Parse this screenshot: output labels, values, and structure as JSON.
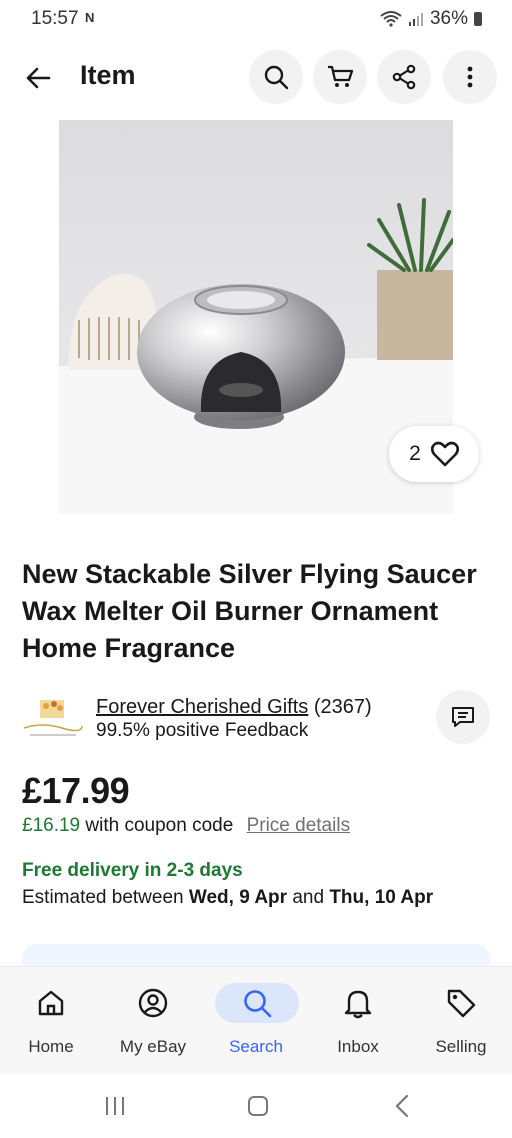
{
  "status": {
    "time": "15:57",
    "notif_icon": "N",
    "battery": "36%"
  },
  "appbar": {
    "title": "Item",
    "icons": [
      "back-arrow-icon",
      "search-icon",
      "cart-icon",
      "share-icon",
      "more-vertical-icon"
    ]
  },
  "listing": {
    "like_count": "2",
    "title": "New Stackable Silver Flying Saucer Wax Melter Oil Burner Ornament Home Fragrance"
  },
  "seller": {
    "name": "Forever Cherished Gifts",
    "count": "(2367)",
    "feedback": "99.5% positive Feedback"
  },
  "pricing": {
    "price": "£17.99",
    "coupon_price": "£16.19",
    "coupon_text": "with coupon code",
    "details_link": "Price details"
  },
  "delivery": {
    "headline": "Free delivery in 2-3 days",
    "estimate_prefix": "Estimated between",
    "date_from": "Wed, 9 Apr",
    "and": "and",
    "date_to": "Thu, 10 Apr"
  },
  "nav": {
    "items": [
      {
        "label": "Home",
        "icon": "home-icon"
      },
      {
        "label": "My eBay",
        "icon": "user-icon"
      },
      {
        "label": "Search",
        "icon": "search-icon",
        "active": true
      },
      {
        "label": "Inbox",
        "icon": "bell-icon"
      },
      {
        "label": "Selling",
        "icon": "tag-icon"
      }
    ]
  },
  "colors": {
    "accent": "#3665f3",
    "green": "#1e7a32",
    "active_pill": "#dbe6fb"
  }
}
